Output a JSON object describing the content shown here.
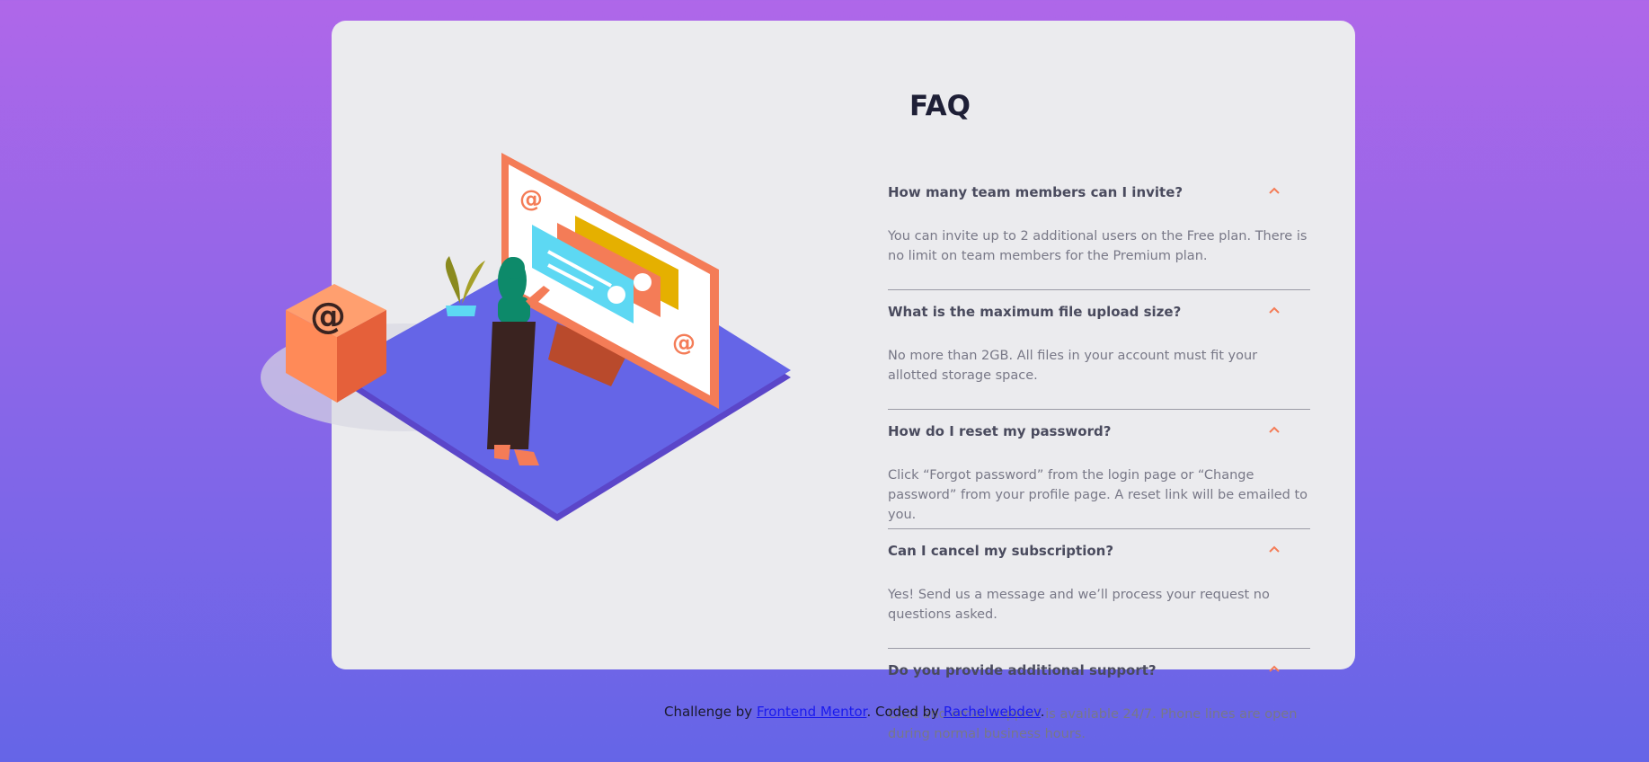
{
  "faq": {
    "title": "FAQ",
    "items": [
      {
        "question": "How many team members can I invite?",
        "answer": "You can invite up to 2 additional users on the Free plan. There is no limit on team members for the Premium plan.",
        "expanded": true
      },
      {
        "question": "What is the maximum file upload size?",
        "answer": "No more than 2GB. All files in your account must fit your allotted storage space.",
        "expanded": true
      },
      {
        "question": "How do I reset my password?",
        "answer": "Click “Forgot password” from the login page or “Change password” from your profile page. A reset link will be emailed to you.",
        "expanded": true
      },
      {
        "question": "Can I cancel my subscription?",
        "answer": "Yes! Send us a message and we’ll process your request no questions asked.",
        "expanded": true
      },
      {
        "question": "Do you provide additional support?",
        "answer": "Chat and email support is available 24/7. Phone lines are open during normal business hours.",
        "expanded": true
      }
    ]
  },
  "attribution": {
    "prefix": "Challenge by ",
    "link1": "Frontend Mentor",
    "middle": ". Coded by ",
    "link2": "Rachelwebdev",
    "suffix": "."
  },
  "colors": {
    "accent": "#f47c57",
    "title": "#1e1f36",
    "card": "#ebebee"
  },
  "icons": {
    "chevron": "chevron-up-icon"
  }
}
